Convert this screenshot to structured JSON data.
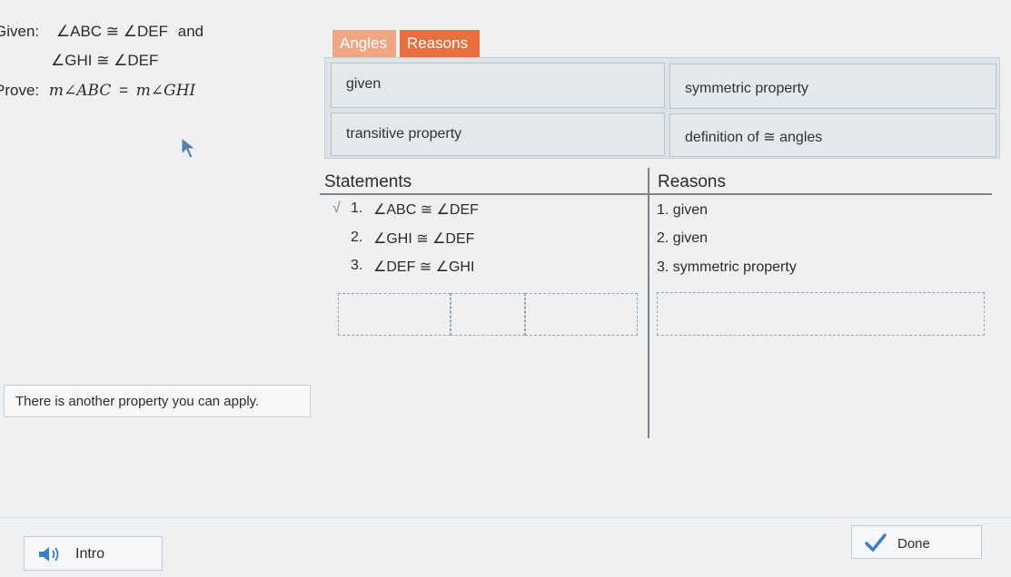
{
  "problem": {
    "given_label": "Given:",
    "given_1": "∠ABC ≅ ∠DEF",
    "given_and": "and",
    "given_2": "∠GHI ≅ ∠DEF",
    "prove_label": "Prove:",
    "prove_left": "m∠ABC",
    "prove_eq": "=",
    "prove_right": "m∠GHI"
  },
  "tabs": [
    {
      "label": "Angles",
      "state": "inactive"
    },
    {
      "label": "Reasons",
      "state": "selected"
    }
  ],
  "bank": [
    {
      "label": "given"
    },
    {
      "label": "symmetric property"
    },
    {
      "label": "transitive property"
    },
    {
      "label": "definition of ≅ angles"
    }
  ],
  "table": {
    "statements_header": "Statements",
    "reasons_header": "Reasons",
    "rows": [
      {
        "num": "1.",
        "statement": "∠ABC ≅ ∠DEF",
        "reason": "1. given",
        "check": "√"
      },
      {
        "num": "2.",
        "statement": "∠GHI ≅ ∠DEF",
        "reason": "2. given"
      },
      {
        "num": "3.",
        "statement": "∠DEF ≅ ∠GHI",
        "reason": "3. symmetric property"
      }
    ]
  },
  "feedback": "There is another property you can apply.",
  "intro_button": "Intro",
  "done_button": "Done",
  "colors": {
    "tab_selected": "#e8703f",
    "tab_inactive": "#f0a683",
    "done_check": "#3f7fbf",
    "speaker": "#3f7fbf"
  }
}
